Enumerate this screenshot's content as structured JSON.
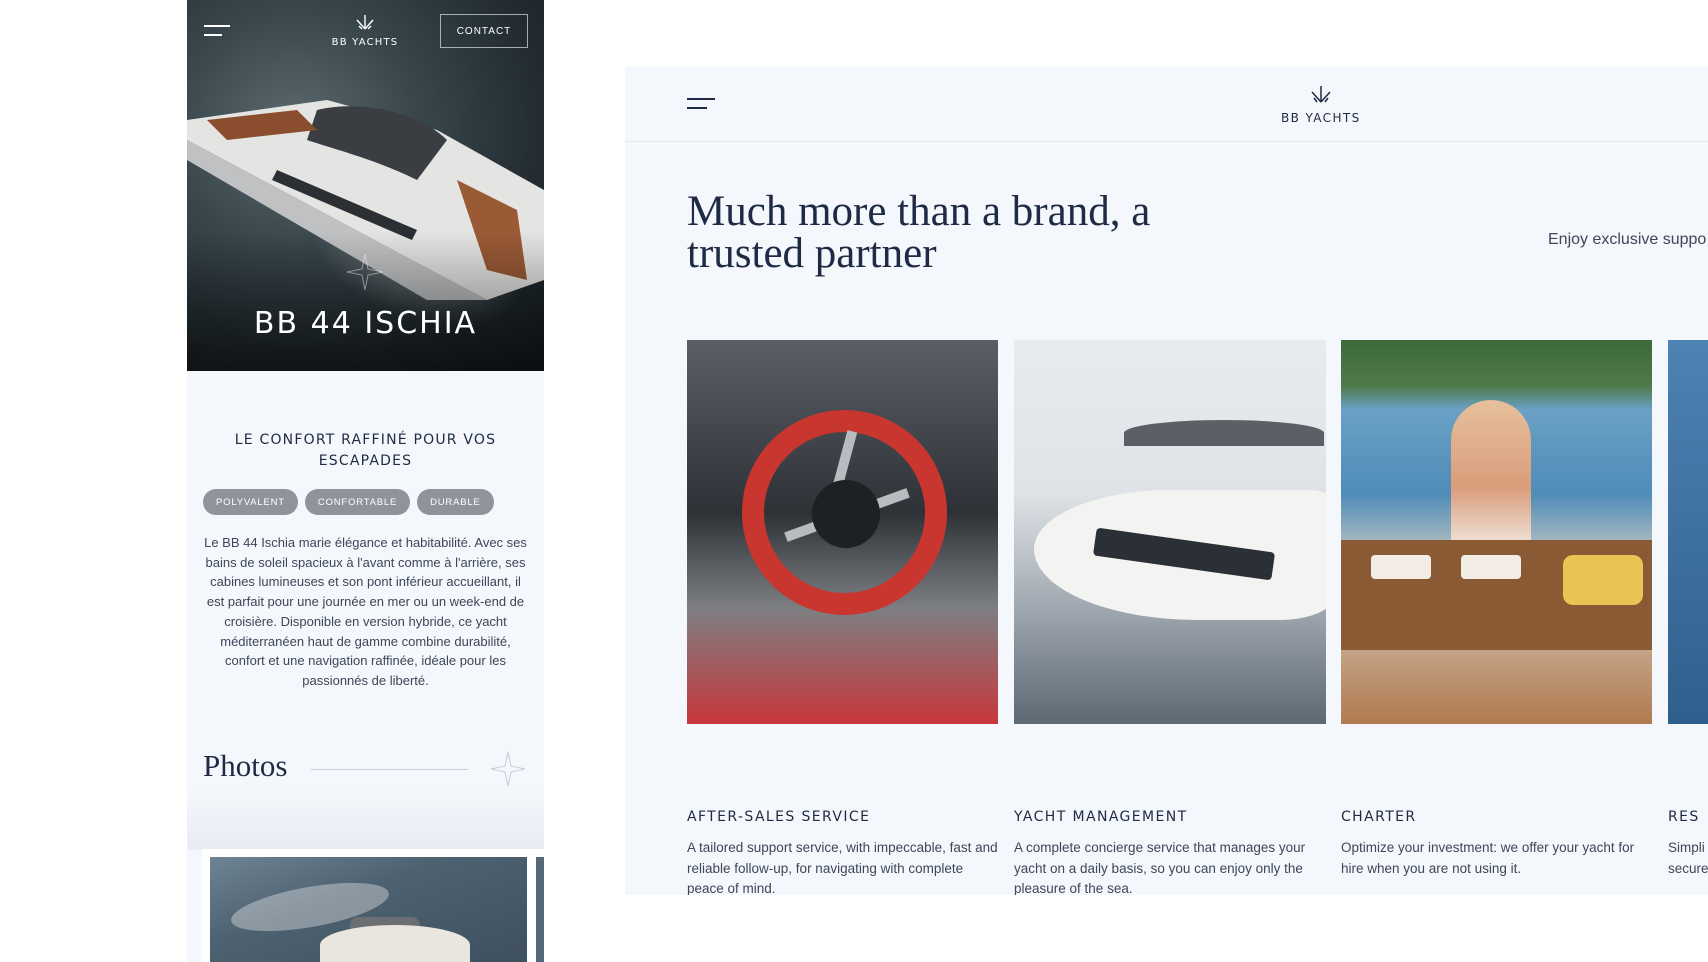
{
  "mobile": {
    "brand": "BB YACHTS",
    "contact_label": "CONTACT",
    "hero_title": "BB 44 ISCHIA",
    "subtitle": "LE CONFORT RAFFINÉ POUR VOS ESCAPADES",
    "tags": [
      "POLYVALENT",
      "CONFORTABLE",
      "DURABLE"
    ],
    "body": "Le BB 44 Ischia marie élégance et habitabilité. Avec ses bains de soleil spacieux à l'avant comme à l'arrière, ses cabines lumineuses et son pont inférieur accueillant, il est parfait pour une journée en mer ou un week-end de croisière. Disponible en version hybride, ce yacht méditerranéen haut de gamme combine durabilité, confort et une navigation raffinée, idéale pour les passionnés de liberté.",
    "photos_heading": "Photos"
  },
  "desktop": {
    "brand": "BB YACHTS",
    "heading": "Much more than a brand, a trusted partner",
    "intro": "Enjoy exclusive suppo",
    "cards": [
      {
        "title": "AFTER-SALES SERVICE",
        "text": " A tailored support service, with impeccable, fast and reliable follow-up, for navigating with complete peace of mind."
      },
      {
        "title": "YACHT MANAGEMENT",
        "text": "A complete concierge service that manages your yacht on a daily basis, so you can enjoy only the pleasure of the sea."
      },
      {
        "title": "CHARTER",
        "text": "Optimize your investment: we offer your yacht for hire when you are not using it."
      },
      {
        "title": "RES",
        "text": "Simpli secure"
      }
    ]
  },
  "colors": {
    "navy": "#1f2a44",
    "page_bg": "#f4f7fb",
    "tag_bg": "#8f949b",
    "steering_red": "#c9362f"
  },
  "icons": [
    "menu-icon",
    "logo-mark-icon",
    "compass-star-icon"
  ]
}
